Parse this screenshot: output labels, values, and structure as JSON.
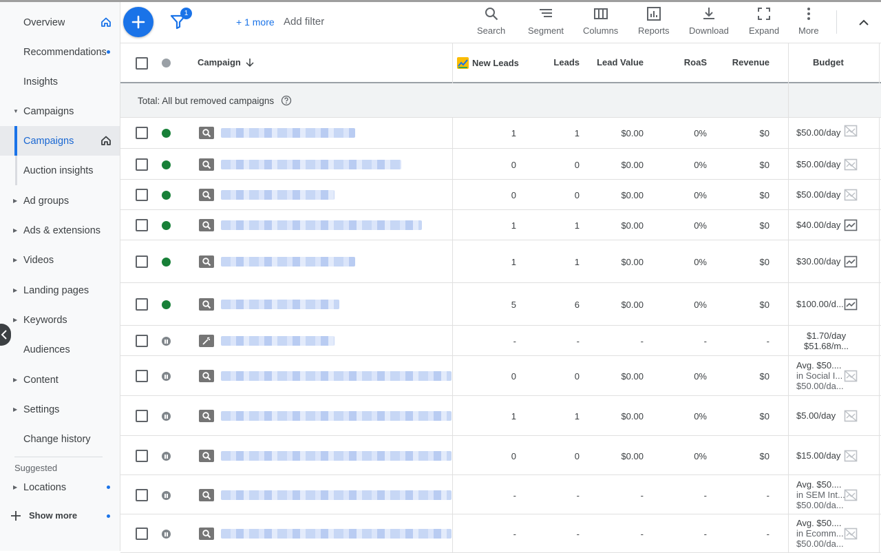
{
  "sidebar": {
    "items": [
      {
        "label": "Overview",
        "has_home_icon": true
      },
      {
        "label": "Recommendations",
        "has_dot": true
      },
      {
        "label": "Insights"
      },
      {
        "label": "Campaigns",
        "expanded": true
      },
      {
        "label": "Campaigns",
        "active": true,
        "has_home_icon": true
      },
      {
        "label": "Auction insights"
      },
      {
        "label": "Ad groups"
      },
      {
        "label": "Ads & extensions"
      },
      {
        "label": "Videos"
      },
      {
        "label": "Landing pages"
      },
      {
        "label": "Keywords"
      },
      {
        "label": "Audiences"
      },
      {
        "label": "Content"
      },
      {
        "label": "Settings"
      },
      {
        "label": "Change history"
      }
    ],
    "suggested_title": "Suggested",
    "suggested_items": [
      {
        "label": "Locations",
        "has_dot": true
      }
    ],
    "show_more": "Show more"
  },
  "toolbar": {
    "filter_count": "1",
    "more_filters": "+ 1 more",
    "add_filter": "Add filter",
    "tools": [
      {
        "label": "Search",
        "icon": "search-icon"
      },
      {
        "label": "Segment",
        "icon": "segment-icon"
      },
      {
        "label": "Columns",
        "icon": "columns-icon"
      },
      {
        "label": "Reports",
        "icon": "reports-icon"
      },
      {
        "label": "Download",
        "icon": "download-icon"
      },
      {
        "label": "Expand",
        "icon": "expand-icon"
      },
      {
        "label": "More",
        "icon": "more-vert-icon"
      }
    ]
  },
  "table": {
    "headers": {
      "campaign": "Campaign",
      "new_leads": "New Leads",
      "leads": "Leads",
      "lead_value": "Lead Value",
      "roas": "RoaS",
      "revenue": "Revenue",
      "budget": "Budget"
    },
    "total_label": "Total: All but removed campaigns",
    "rows": [
      {
        "status": "enabled",
        "type": "search",
        "new_leads": "1",
        "leads": "1",
        "lead_value": "$0.00",
        "roas": "0%",
        "revenue": "$0",
        "budget": [
          "$50.00/day"
        ],
        "budget_icon": "chart-off"
      },
      {
        "status": "enabled",
        "type": "search",
        "new_leads": "0",
        "leads": "0",
        "lead_value": "$0.00",
        "roas": "0%",
        "revenue": "$0",
        "budget": [
          "$50.00/day"
        ],
        "budget_icon": "chart-off"
      },
      {
        "status": "enabled",
        "type": "search",
        "new_leads": "0",
        "leads": "0",
        "lead_value": "$0.00",
        "roas": "0%",
        "revenue": "$0",
        "budget": [
          "$50.00/day"
        ],
        "budget_icon": "chart-off"
      },
      {
        "status": "enabled",
        "type": "search",
        "new_leads": "1",
        "leads": "1",
        "lead_value": "$0.00",
        "roas": "0%",
        "revenue": "$0",
        "budget": [
          "$40.00/day"
        ],
        "budget_icon": "chart-on"
      },
      {
        "status": "enabled",
        "type": "search",
        "new_leads": "1",
        "leads": "1",
        "lead_value": "$0.00",
        "roas": "0%",
        "revenue": "$0",
        "budget": [
          "$30.00/day"
        ],
        "budget_icon": "chart-on"
      },
      {
        "status": "enabled",
        "type": "search",
        "new_leads": "5",
        "leads": "6",
        "lead_value": "$0.00",
        "roas": "0%",
        "revenue": "$0",
        "budget": [
          "$100.00/d..."
        ],
        "budget_icon": "chart-on"
      },
      {
        "status": "paused",
        "type": "smart",
        "new_leads": "-",
        "leads": "-",
        "lead_value": "-",
        "roas": "-",
        "revenue": "-",
        "budget": [
          "$1.70/day",
          "$51.68/m..."
        ],
        "budget_icon": ""
      },
      {
        "status": "paused",
        "type": "search",
        "new_leads": "0",
        "leads": "0",
        "lead_value": "$0.00",
        "roas": "0%",
        "revenue": "$0",
        "budget": [
          "Avg. $50....",
          "in Social I...",
          "$50.00/da..."
        ],
        "budget_icon": "chart-off"
      },
      {
        "status": "paused",
        "type": "search",
        "new_leads": "1",
        "leads": "1",
        "lead_value": "$0.00",
        "roas": "0%",
        "revenue": "$0",
        "budget": [
          "$5.00/day"
        ],
        "budget_icon": "chart-off"
      },
      {
        "status": "paused",
        "type": "search",
        "new_leads": "0",
        "leads": "0",
        "lead_value": "$0.00",
        "roas": "0%",
        "revenue": "$0",
        "budget": [
          "$15.00/day"
        ],
        "budget_icon": "chart-off"
      },
      {
        "status": "paused",
        "type": "search",
        "new_leads": "-",
        "leads": "-",
        "lead_value": "-",
        "roas": "-",
        "revenue": "-",
        "budget": [
          "Avg. $50....",
          "in SEM Int...",
          "$50.00/da..."
        ],
        "budget_icon": "chart-off"
      },
      {
        "status": "paused",
        "type": "search",
        "new_leads": "-",
        "leads": "-",
        "lead_value": "-",
        "roas": "-",
        "revenue": "-",
        "budget": [
          "Avg. $50....",
          "in Ecomm...",
          "$50.00/da..."
        ],
        "budget_icon": "chart-off"
      }
    ]
  },
  "colors": {
    "accent": "#1a73e8",
    "enabled": "#188038",
    "paused": "#80868b"
  }
}
